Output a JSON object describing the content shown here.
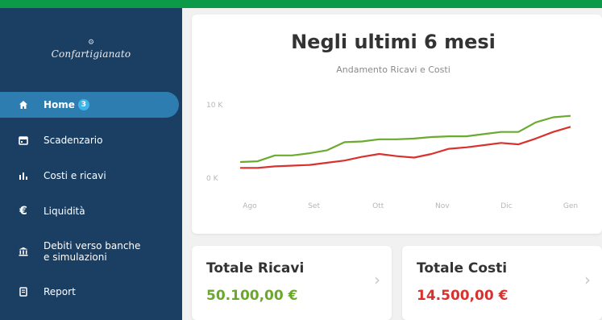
{
  "logo": {
    "mark": "⚙",
    "text": "Confartigianato"
  },
  "sidebar": {
    "items": [
      {
        "label": "Home",
        "icon": "home-icon",
        "badge": "3"
      },
      {
        "label": "Scadenzario",
        "icon": "calendar-icon"
      },
      {
        "label": "Costi e ricavi",
        "icon": "bar-chart-icon"
      },
      {
        "label": "Liquidità",
        "icon": "euro-icon"
      },
      {
        "label": "Debiti verso banche",
        "label2": "e simulazioni",
        "icon": "bank-icon"
      },
      {
        "label": "Report",
        "icon": "report-icon"
      }
    ]
  },
  "chart_card": {
    "title": "Negli ultimi 6 mesi",
    "subtitle": "Andamento Ricavi e Costi"
  },
  "chart_data": {
    "type": "line",
    "x": [
      "Ago",
      "",
      "Set",
      "",
      "Ott",
      "",
      "Nov",
      "",
      "Dic",
      "",
      "Gen"
    ],
    "x_tick_labels": [
      "Ago",
      "Set",
      "Ott",
      "Nov",
      "Dic",
      "Gen"
    ],
    "y_tick_labels": [
      "0 K",
      "10 K"
    ],
    "ylim": [
      0,
      10
    ],
    "series": [
      {
        "color": "#6aab2e",
        "values": [
          2.2,
          2.3,
          3.1,
          3.1,
          3.4,
          3.8,
          4.9,
          5.0,
          5.3,
          5.3,
          5.4,
          5.6,
          5.7,
          5.7,
          6.0,
          6.3,
          6.3,
          7.6,
          8.3,
          8.5
        ]
      },
      {
        "color": "#d8322e",
        "values": [
          1.4,
          1.4,
          1.6,
          1.7,
          1.8,
          2.1,
          2.4,
          2.9,
          3.3,
          3.0,
          2.8,
          3.3,
          4.0,
          4.2,
          4.5,
          4.8,
          4.6,
          5.4,
          6.3,
          7.0
        ]
      }
    ],
    "grid": false
  },
  "stats": {
    "ricavi": {
      "label": "Totale Ricavi",
      "value": "50.100,00 €",
      "color": "#6aa82a"
    },
    "costi": {
      "label": "Totale Costi",
      "value": "14.500,00 €",
      "color": "#d8322e"
    }
  },
  "colors": {
    "topbar": "#0c9a49",
    "sidebar": "#1b3f63",
    "active": "#2e7db0"
  }
}
